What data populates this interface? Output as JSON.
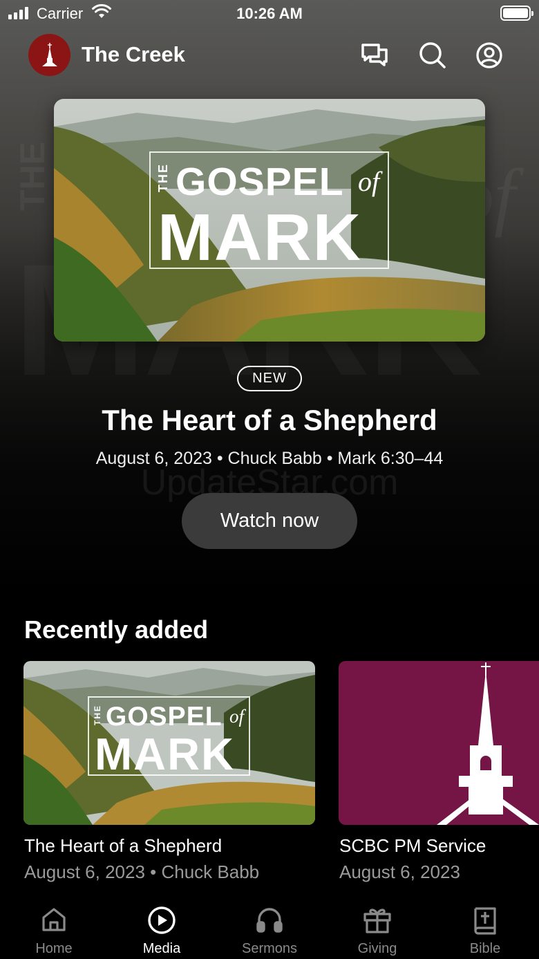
{
  "status_bar": {
    "carrier": "Carrier",
    "time": "10:26 AM"
  },
  "header": {
    "app_title": "The Creek",
    "icons": [
      "messages-icon",
      "search-icon",
      "profile-icon"
    ]
  },
  "hero": {
    "artwork": {
      "the": "THE",
      "gospel": "GOSPEL",
      "of": "of",
      "mark": "MARK"
    },
    "badge": "NEW",
    "title": "The Heart of a Shepherd",
    "meta": "August 6, 2023 • Chuck Babb • Mark 6:30–44",
    "watermark": "UpdateStar.com",
    "watch_label": "Watch now"
  },
  "recently_added": {
    "title": "Recently added",
    "items": [
      {
        "artwork": {
          "the": "THE",
          "gospel": "GOSPEL",
          "of": "of",
          "mark": "MARK"
        },
        "title": "The Heart of a Shepherd",
        "meta": "August 6, 2023 • Chuck Babb"
      },
      {
        "title": "SCBC PM Service",
        "meta": "August 6, 2023",
        "color": "#741545"
      }
    ]
  },
  "tabs": [
    {
      "label": "Home",
      "icon": "home-icon",
      "active": false
    },
    {
      "label": "Media",
      "icon": "play-circle-icon",
      "active": true
    },
    {
      "label": "Sermons",
      "icon": "headphones-icon",
      "active": false
    },
    {
      "label": "Giving",
      "icon": "gift-icon",
      "active": false
    },
    {
      "label": "Bible",
      "icon": "bible-icon",
      "active": false
    }
  ],
  "colors": {
    "logo_red": "#8b1515",
    "service_maroon": "#741545",
    "button_gray": "#3b3b3b"
  }
}
